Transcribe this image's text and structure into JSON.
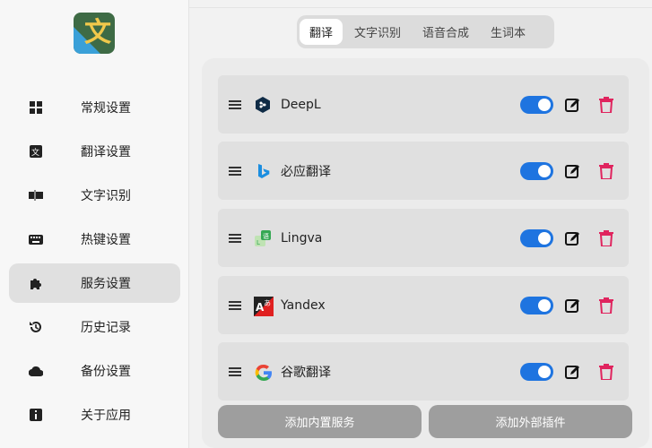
{
  "sidebar": {
    "logo_icon": "app-logo",
    "items": [
      {
        "label": "常规设置",
        "icon": "grid-icon"
      },
      {
        "label": "翻译设置",
        "icon": "translate-icon"
      },
      {
        "label": "文字识别",
        "icon": "ocr-icon"
      },
      {
        "label": "热键设置",
        "icon": "keyboard-icon"
      },
      {
        "label": "服务设置",
        "icon": "puzzle-icon",
        "active": true
      },
      {
        "label": "历史记录",
        "icon": "history-icon"
      },
      {
        "label": "备份设置",
        "icon": "cloud-icon"
      },
      {
        "label": "关于应用",
        "icon": "info-icon"
      }
    ]
  },
  "tabs": [
    {
      "label": "翻译",
      "active": true
    },
    {
      "label": "文字识别"
    },
    {
      "label": "语音合成"
    },
    {
      "label": "生词本"
    }
  ],
  "services": [
    {
      "name": "DeepL",
      "icon": "deepl-icon",
      "enabled": true
    },
    {
      "name": "必应翻译",
      "icon": "bing-icon",
      "enabled": true
    },
    {
      "name": "Lingva",
      "icon": "lingva-icon",
      "enabled": true
    },
    {
      "name": "Yandex",
      "icon": "yandex-icon",
      "enabled": true
    },
    {
      "name": "谷歌翻译",
      "icon": "google-icon",
      "enabled": true
    }
  ],
  "buttons": {
    "add_builtin": "添加内置服务",
    "add_plugin": "添加外部插件"
  },
  "colors": {
    "toggle_on": "#1e74e0",
    "delete": "#e0245e",
    "active_nav_bg": "#e0e0e0"
  }
}
